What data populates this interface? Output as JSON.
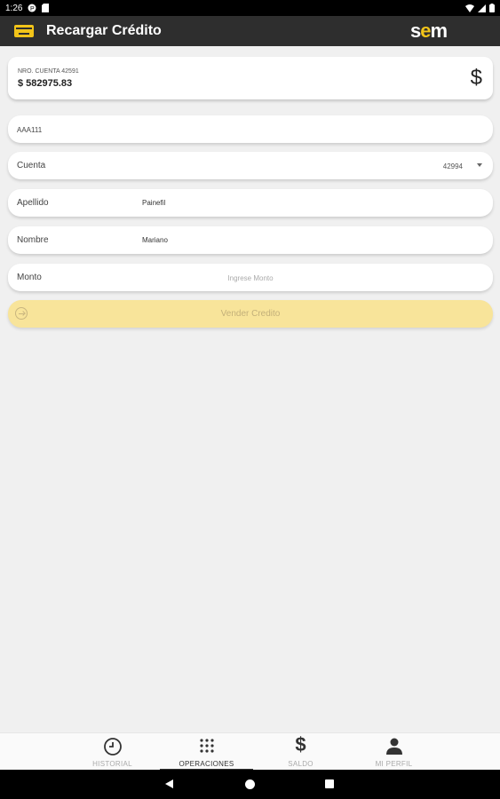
{
  "status": {
    "time": "1:26"
  },
  "app_bar": {
    "title": "Recargar Crédito",
    "logo_pre": "s",
    "logo_mid": "e",
    "logo_post": "m"
  },
  "balance": {
    "account_label": "NRO. CUENTA 42591",
    "amount": "$ 582975.83",
    "currency_symbol": "$"
  },
  "form": {
    "plate": "AAA111",
    "account": {
      "label": "Cuenta",
      "value": "42994"
    },
    "last_name": {
      "label": "Apellido",
      "value": "Painefil"
    },
    "first_name": {
      "label": "Nombre",
      "value": "Mariano"
    },
    "amount": {
      "label": "Monto",
      "placeholder": "Ingrese Monto"
    },
    "submit_label": "Vender Credito"
  },
  "bottom_nav": {
    "items": [
      {
        "label": "HISTORIAL",
        "icon": "clock-icon"
      },
      {
        "label": "OPERACIONES",
        "icon": "grid-icon"
      },
      {
        "label": "SALDO",
        "icon": "dollar-icon"
      },
      {
        "label": "MI PERFIL",
        "icon": "person-icon"
      }
    ],
    "active_index": 1
  },
  "colors": {
    "accent": "#f2c419",
    "app_bar": "#2e2e2e",
    "button_disabled": "#f8e49a"
  }
}
